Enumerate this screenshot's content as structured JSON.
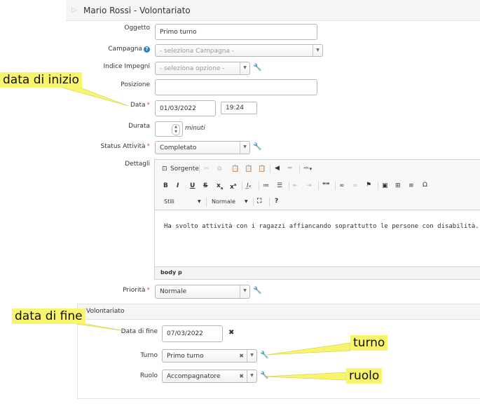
{
  "header": {
    "title": "Mario Rossi - Volontariato"
  },
  "form": {
    "oggetto": {
      "label": "Oggetto",
      "value": "Primo turno"
    },
    "campagna": {
      "label": "Campagna",
      "placeholder": "- seleziona Campagna -"
    },
    "indice": {
      "label": "Indice Impegni",
      "placeholder": "- seleziona opzione -"
    },
    "posizione": {
      "label": "Posizione",
      "value": ""
    },
    "data": {
      "label": "Data",
      "date": "01/03/2022",
      "time": "19:24"
    },
    "durata": {
      "label": "Durata",
      "unit": "minuti"
    },
    "status": {
      "label": "Status Attività",
      "value": "Completato"
    },
    "dettagli": {
      "label": "Dettagli"
    },
    "priorita": {
      "label": "Priorità",
      "value": "Normale"
    }
  },
  "editor": {
    "source_label": "Sorgente",
    "styles_label": "Stili",
    "format_label": "Normale",
    "help_glyph": "?",
    "content": "Ha svolto attività con i ragazzi affiancando soprattutto le persone con disabilità.",
    "path": [
      "body",
      "p"
    ]
  },
  "volontariato": {
    "title": "Volontariato",
    "data_fine": {
      "label": "Data di fine",
      "value": "07/03/2022"
    },
    "turno": {
      "label": "Turno",
      "value": "Primo turno"
    },
    "ruolo": {
      "label": "Ruolo",
      "value": "Accompagnatore"
    }
  },
  "callouts": {
    "data_inizio": "data di inizio",
    "data_fine": "data di fine",
    "turno": "turno",
    "ruolo": "ruolo"
  },
  "colors": {
    "callout": "#f8f46b",
    "required": "#d9534f",
    "help": "#2f7fc1"
  }
}
